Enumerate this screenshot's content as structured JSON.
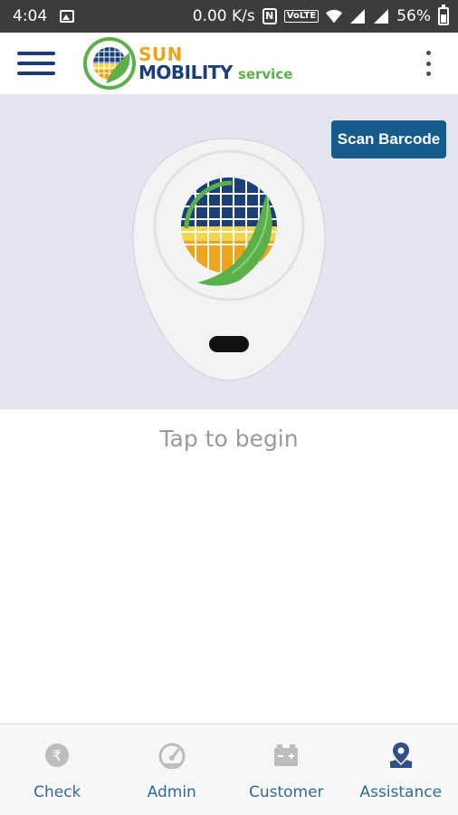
{
  "status_bar": {
    "time": "4:04",
    "speed": "0.00 K/s",
    "nfc": "N",
    "volte": "VoLTE",
    "battery": "56%"
  },
  "app_bar": {
    "brand_line1": "SUN",
    "brand_line2": "MOBILITY",
    "brand_line3": "service",
    "menu_icon": "hamburger-icon",
    "overflow_icon": "more-vert-icon"
  },
  "hero": {
    "scan_button": "Scan Barcode"
  },
  "main": {
    "tap_text": "Tap to begin"
  },
  "bottom_nav": {
    "items": [
      {
        "label": "Check",
        "icon": "rupee-coin-icon"
      },
      {
        "label": "Admin",
        "icon": "speedometer-icon"
      },
      {
        "label": "Customer",
        "icon": "battery-icon"
      },
      {
        "label": "Assistance",
        "icon": "location-pin-icon"
      }
    ]
  },
  "colors": {
    "brand_blue": "#1b3f78",
    "brand_orange": "#f0a41c",
    "brand_green": "#5cb04a",
    "button_blue": "#155c8c",
    "hero_bg": "#e5e5f1",
    "active_nav_icon": "#2f4f86",
    "inactive_nav_icon": "#b8b8b8"
  }
}
